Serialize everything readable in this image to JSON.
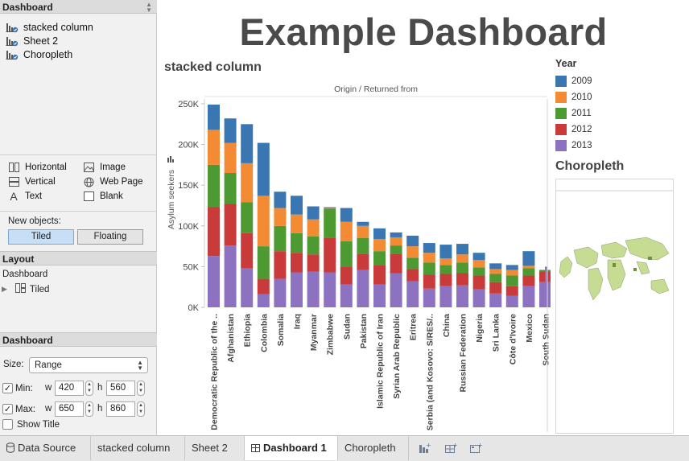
{
  "left_panel": {
    "dashboard_header": "Dashboard",
    "sheets": [
      {
        "label": "stacked column",
        "icon": "bar-chart-sheet-icon"
      },
      {
        "label": "Sheet 2",
        "icon": "bar-chart-sheet-icon"
      },
      {
        "label": "Choropleth",
        "icon": "bar-chart-sheet-icon"
      }
    ],
    "objects": {
      "horizontal": "Horizontal",
      "vertical": "Vertical",
      "text": "Text",
      "image": "Image",
      "web_page": "Web Page",
      "blank": "Blank"
    },
    "new_objects_label": "New objects:",
    "tiled_label": "Tiled",
    "floating_label": "Floating",
    "layout_header": "Layout",
    "layout_root": "Dashboard",
    "layout_child": "Tiled",
    "size_header": "Dashboard",
    "size_label": "Size:",
    "size_value": "Range",
    "min_label": "Min:",
    "max_label": "Max:",
    "w_label": "w",
    "h_label": "h",
    "min_w": "420",
    "min_h": "560",
    "max_w": "650",
    "max_h": "860",
    "show_title_label": "Show Title"
  },
  "dashboard": {
    "title": "Example Dashboard",
    "chart_title": "stacked column",
    "legend_title": "Year",
    "choropleth_title": "Choropleth"
  },
  "colors": {
    "2009": "#3a77b2",
    "2010": "#f28b34",
    "2011": "#4d9a32",
    "2012": "#c93a3a",
    "2013": "#8e72c2"
  },
  "chart_data": {
    "type": "bar",
    "stacked": true,
    "header": "Origin / Returned from",
    "ylabel": "Asylum seekers",
    "ylim": [
      0,
      250000
    ],
    "yticks": [
      0,
      50000,
      100000,
      150000,
      200000,
      250000
    ],
    "ytick_labels": [
      "0K",
      "50K",
      "100K",
      "150K",
      "200K",
      "250K"
    ],
    "categories": [
      "Democratic Republic of the ..",
      "Afghanistan",
      "Ethiopia",
      "Colombia",
      "Somalia",
      "Iraq",
      "Myanmar",
      "Zimbabwe",
      "Sudan",
      "Pakistan",
      "Islamic Republic of Iran",
      "Syrian Arab Republic",
      "Eritrea",
      "Serbia (and Kosovo: S/RES/..",
      "China",
      "Russian Federation",
      "Nigeria",
      "Sri Lanka",
      "Côte d'Ivoire",
      "Mexico",
      "South Sudan"
    ],
    "series": [
      {
        "name": "2013",
        "values": [
          63000,
          76000,
          48000,
          16000,
          35000,
          43000,
          44000,
          43000,
          28000,
          46000,
          28000,
          42000,
          32000,
          23000,
          26000,
          27000,
          22000,
          17000,
          14000,
          26000,
          31000
        ]
      },
      {
        "name": "2012",
        "values": [
          60000,
          51000,
          43000,
          19000,
          34000,
          24000,
          21000,
          42000,
          22000,
          20000,
          24000,
          24000,
          15000,
          17000,
          15000,
          15000,
          17000,
          14000,
          12000,
          13000,
          13000
        ]
      },
      {
        "name": "2011",
        "values": [
          52000,
          38000,
          38000,
          40000,
          31000,
          24000,
          22000,
          36000,
          31000,
          19000,
          17000,
          10000,
          14000,
          15000,
          11000,
          13000,
          10000,
          10000,
          13000,
          9000,
          2000
        ]
      },
      {
        "name": "2010",
        "values": [
          43000,
          37000,
          48000,
          62000,
          22000,
          23000,
          21000,
          1000,
          24000,
          15000,
          15000,
          10000,
          14000,
          12000,
          8000,
          10000,
          9000,
          6000,
          7000,
          3000,
          0
        ]
      },
      {
        "name": "2009",
        "values": [
          31000,
          30000,
          48000,
          65000,
          20000,
          23000,
          16000,
          1000,
          17000,
          5000,
          13000,
          6000,
          13000,
          12000,
          17000,
          13000,
          9000,
          7000,
          6000,
          18000,
          0
        ]
      }
    ]
  }
}
